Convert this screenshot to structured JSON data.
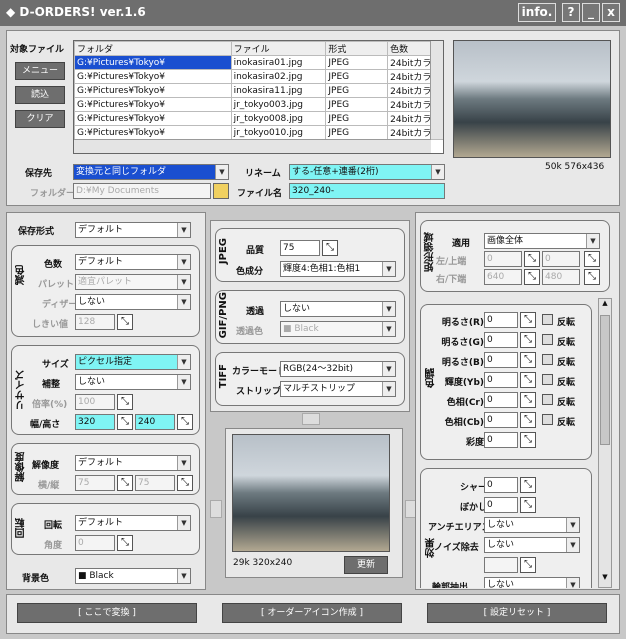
{
  "title": "◆ D-ORDERS! ver.1.6",
  "info_label": "info.",
  "help_label": "?",
  "min_label": "_",
  "close_label": "x",
  "target_files_label": "対象ファイル",
  "menu_label": "メニュー",
  "read_label": "読込",
  "clear_label": "クリア",
  "file_table": {
    "headers": [
      "フォルダ",
      "ファイル",
      "形式",
      "色数"
    ],
    "rows": [
      [
        "G:¥Pictures¥Tokyo¥",
        "inokasira01.jpg",
        "JPEG",
        "24bitカラー"
      ],
      [
        "G:¥Pictures¥Tokyo¥",
        "inokasira02.jpg",
        "JPEG",
        "24bitカラー"
      ],
      [
        "G:¥Pictures¥Tokyo¥",
        "inokasira11.jpg",
        "JPEG",
        "24bitカラー"
      ],
      [
        "G:¥Pictures¥Tokyo¥",
        "jr_tokyo003.jpg",
        "JPEG",
        "24bitカラー"
      ],
      [
        "G:¥Pictures¥Tokyo¥",
        "jr_tokyo008.jpg",
        "JPEG",
        "24bitカラー"
      ],
      [
        "G:¥Pictures¥Tokyo¥",
        "jr_tokyo010.jpg",
        "JPEG",
        "24bitカラー"
      ]
    ]
  },
  "preview_info": "50k 576x436",
  "save_dest_label": "保存先",
  "save_dest_value": "変換元と同じフォルダ",
  "rename_label": "リネーム",
  "rename_value": "する-任意+連番(2桁)",
  "folder_label": "フォルダー",
  "folder_value": "D:¥My Documents",
  "filename_label": "ファイル名",
  "filename_value": "320_240-",
  "format_label": "保存形式",
  "format_value": "デフォルト",
  "color_reduce": {
    "section": "減色",
    "colors_label": "色数",
    "colors_value": "デフォルト",
    "palette_label": "パレット",
    "palette_value": "適宜パレット",
    "dither_label": "ディザー",
    "dither_value": "しない",
    "threshold_label": "しきい値",
    "threshold_value": "128"
  },
  "resize": {
    "section": "リサイズ",
    "size_label": "サイズ",
    "size_value": "ピクセル指定",
    "interp_label": "補整",
    "interp_value": "しない",
    "ratio_label": "倍率(%)",
    "ratio_value": "100",
    "wh_label": "幅/高さ",
    "width": "320",
    "height": "240"
  },
  "resolution": {
    "section": "解像度",
    "label": "解像度",
    "value": "デフォルト",
    "hv_label": "横/縦",
    "h": "75",
    "v": "75"
  },
  "rotate": {
    "section": "回転",
    "label": "回転",
    "value": "デフォルト",
    "angle_label": "角度",
    "angle_value": "0"
  },
  "bg_label": "背景色",
  "bg_value": "■ Black",
  "jpeg": {
    "section": "JPEG",
    "quality_label": "品質",
    "quality_value": "75",
    "sub_label": "色成分",
    "sub_value": "輝度4:色相1:色相1"
  },
  "gif": {
    "section": "GIF/PNG",
    "trans_label": "透過",
    "trans_value": "しない",
    "tcolor_label": "透過色",
    "tcolor_value": "■ Black"
  },
  "tiff": {
    "section": "TIFF",
    "mode_label": "カラーモード",
    "mode_value": "RGB(24～32bit)",
    "strip_label": "ストリップ",
    "strip_value": "マルチストリップ"
  },
  "result_info": "29k 320x240",
  "update_label": "更新",
  "area": {
    "section": "矩形領域",
    "apply_label": "適用",
    "apply_value": "画像全体",
    "lt_label": "左/上端",
    "l": "0",
    "t": "0",
    "rb_label": "右/下端",
    "r": "640",
    "b": "480"
  },
  "tone": {
    "section": "色調",
    "invert_label": "反転",
    "rows": [
      [
        "明るさ(R)",
        "0"
      ],
      [
        "明るさ(G)",
        "0"
      ],
      [
        "明るさ(B)",
        "0"
      ],
      [
        "輝度(Yb)",
        "0"
      ],
      [
        "色相(Cr)",
        "0"
      ],
      [
        "色相(Cb)",
        "0"
      ],
      [
        "彩度",
        "0"
      ]
    ]
  },
  "effect": {
    "section": "効果",
    "sharp_label": "シャープ",
    "sharp_value": "0",
    "blur_label": "ぼかし",
    "blur_value": "0",
    "aa_label": "アンチエリアス",
    "aa_value": "しない",
    "noise_label": "ノイズ除去",
    "noise_value": "しない",
    "edge_label": "輪郭抽出",
    "edge_value": "しない"
  },
  "convert_label": "[ ここで変換 ]",
  "icon_label": "[ オーダーアイコン作成 ]",
  "reset_label": "[ 設定リセット ]"
}
